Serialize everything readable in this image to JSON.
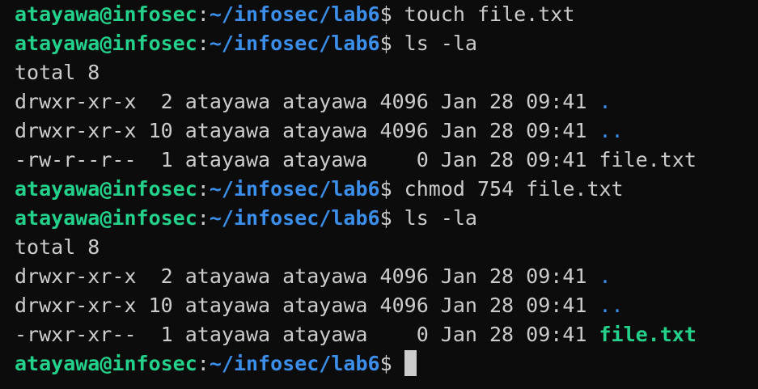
{
  "prompt": {
    "user_host": "atayawa@infosec",
    "colon": ":",
    "path": "~/infosec/lab6",
    "dollar": "$ "
  },
  "lines": [
    {
      "type": "prompt",
      "command": "touch file.txt"
    },
    {
      "type": "prompt",
      "command": "ls -la"
    },
    {
      "type": "output",
      "text": "total 8"
    },
    {
      "type": "ls",
      "meta": "drwxr-xr-x  2 atayawa atayawa 4096 Jan 28 09:41 ",
      "name": ".",
      "kind": "dir"
    },
    {
      "type": "ls",
      "meta": "drwxr-xr-x 10 atayawa atayawa 4096 Jan 28 09:41 ",
      "name": "..",
      "kind": "dir"
    },
    {
      "type": "ls",
      "meta": "-rw-r--r--  1 atayawa atayawa    0 Jan 28 09:41 ",
      "name": "file.txt",
      "kind": "file"
    },
    {
      "type": "prompt",
      "command": "chmod 754 file.txt"
    },
    {
      "type": "prompt",
      "command": "ls -la"
    },
    {
      "type": "output",
      "text": "total 8"
    },
    {
      "type": "ls",
      "meta": "drwxr-xr-x  2 atayawa atayawa 4096 Jan 28 09:41 ",
      "name": ".",
      "kind": "dir"
    },
    {
      "type": "ls",
      "meta": "drwxr-xr-x 10 atayawa atayawa 4096 Jan 28 09:41 ",
      "name": "..",
      "kind": "dir"
    },
    {
      "type": "ls",
      "meta": "-rwxr-xr--  1 atayawa atayawa    0 Jan 28 09:41 ",
      "name": "file.txt",
      "kind": "exec"
    },
    {
      "type": "prompt",
      "command": "",
      "cursor": true
    }
  ],
  "colors": {
    "background": "#0c0c0c",
    "text": "#cccccc",
    "user_host": "#23d18b",
    "path": "#3b8eea",
    "directory": "#3b8eea",
    "executable": "#23d18b"
  }
}
